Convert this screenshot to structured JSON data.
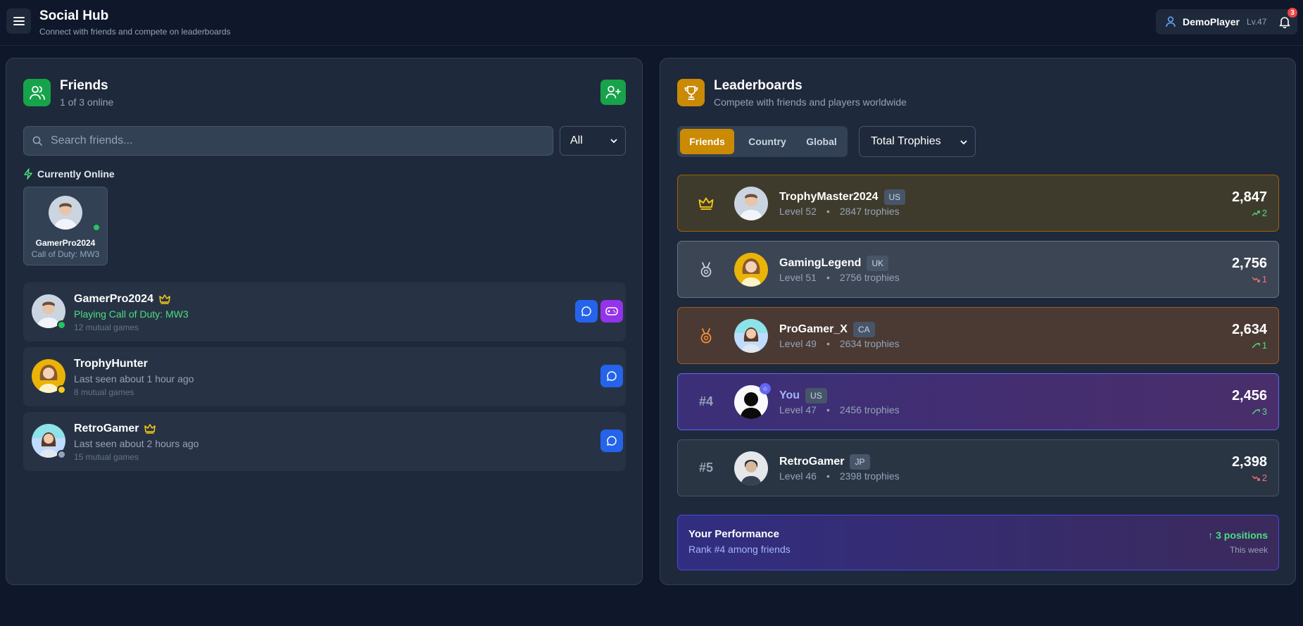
{
  "header": {
    "title": "Social Hub",
    "subtitle": "Connect with friends and compete on leaderboards",
    "user": {
      "name": "DemoPlayer",
      "level": "Lv.47"
    },
    "notifications": "3"
  },
  "friends_panel": {
    "title": "Friends",
    "subtitle": "1 of 3 online",
    "search_placeholder": "Search friends...",
    "filter_value": "All",
    "online_section_label": "Currently Online",
    "online_card": {
      "name": "GamerPro2024",
      "game": "Call of Duty: MW3"
    },
    "friends": [
      {
        "name": "GamerPro2024",
        "status": "Playing Call of Duty: MW3",
        "mutual": "12 mutual games",
        "presence": "online",
        "crown": true
      },
      {
        "name": "TrophyHunter",
        "status": "Last seen about 1 hour ago",
        "mutual": "8 mutual games",
        "presence": "away",
        "crown": false
      },
      {
        "name": "RetroGamer",
        "status": "Last seen about 2 hours ago",
        "mutual": "15 mutual games",
        "presence": "offline",
        "crown": true
      }
    ]
  },
  "leaderboard_panel": {
    "title": "Leaderboards",
    "subtitle": "Compete with friends and players worldwide",
    "tabs": [
      "Friends",
      "Country",
      "Global"
    ],
    "active_tab": "Friends",
    "metric_value": "Total Trophies",
    "entries": [
      {
        "rank": "",
        "rank_icon": "crown-icon",
        "name": "TrophyMaster2024",
        "country": "US",
        "level": "Level 52",
        "trophies": "2847 trophies",
        "score": "2,847",
        "delta": "2",
        "trend": "up"
      },
      {
        "rank": "",
        "rank_icon": "silver-medal-icon",
        "name": "GamingLegend",
        "country": "UK",
        "level": "Level 51",
        "trophies": "2756 trophies",
        "score": "2,756",
        "delta": "1",
        "trend": "down"
      },
      {
        "rank": "",
        "rank_icon": "bronze-medal-icon",
        "name": "ProGamer_X",
        "country": "CA",
        "level": "Level 49",
        "trophies": "2634 trophies",
        "score": "2,634",
        "delta": "1",
        "trend": "up"
      },
      {
        "rank": "#4",
        "rank_icon": "",
        "name": "You",
        "country": "US",
        "level": "Level 47",
        "trophies": "2456 trophies",
        "score": "2,456",
        "delta": "3",
        "trend": "up"
      },
      {
        "rank": "#5",
        "rank_icon": "",
        "name": "RetroGamer",
        "country": "JP",
        "level": "Level 46",
        "trophies": "2398 trophies",
        "score": "2,398",
        "delta": "2",
        "trend": "down"
      }
    ],
    "performance": {
      "title": "Your Performance",
      "subtitle": "Rank #4 among friends",
      "change": "↑ 3 positions",
      "period": "This week"
    }
  },
  "colors": {
    "background": "#0f172a",
    "panel": "#1e293b",
    "green_accent": "#16a34a",
    "gold_accent": "#ca8a04",
    "blue_button": "#2563eb",
    "purple_button": "#9333ea",
    "indigo_highlight": "#6366f1"
  }
}
